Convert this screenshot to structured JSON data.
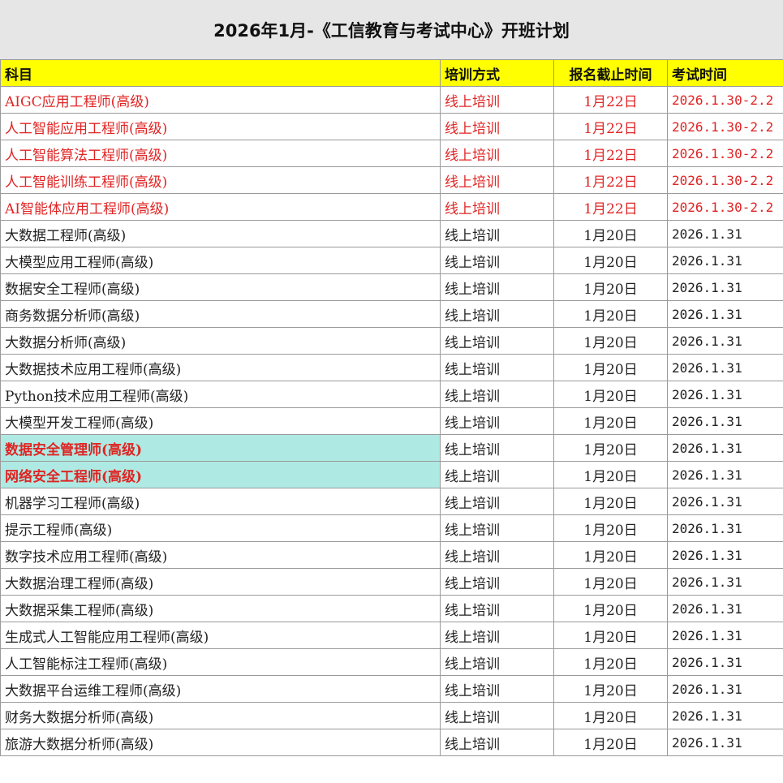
{
  "title": "2026年1月-《工信教育与考试中心》开班计划",
  "headers": {
    "subject": "科目",
    "mode": "培训方式",
    "deadline": "报名截止时间",
    "exam": "考试时间"
  },
  "colors": {
    "header_bg": "#ffff00",
    "highlight_bg": "#aeeae3",
    "red_text": "#e02424"
  },
  "rows": [
    {
      "subject": "AIGC应用工程师(高级)",
      "mode": "线上培训",
      "deadline": "1月22日",
      "exam": "2026.1.30-2.2",
      "style": "red"
    },
    {
      "subject": "人工智能应用工程师(高级)",
      "mode": "线上培训",
      "deadline": "1月22日",
      "exam": "2026.1.30-2.2",
      "style": "red"
    },
    {
      "subject": "人工智能算法工程师(高级)",
      "mode": "线上培训",
      "deadline": "1月22日",
      "exam": "2026.1.30-2.2",
      "style": "red"
    },
    {
      "subject": "人工智能训练工程师(高级)",
      "mode": "线上培训",
      "deadline": "1月22日",
      "exam": "2026.1.30-2.2",
      "style": "red"
    },
    {
      "subject": "AI智能体应用工程师(高级)",
      "mode": "线上培训",
      "deadline": "1月22日",
      "exam": "2026.1.30-2.2",
      "style": "red"
    },
    {
      "subject": "大数据工程师(高级)",
      "mode": "线上培训",
      "deadline": "1月20日",
      "exam": "2026.1.31",
      "style": "normal"
    },
    {
      "subject": "大模型应用工程师(高级)",
      "mode": "线上培训",
      "deadline": "1月20日",
      "exam": "2026.1.31",
      "style": "normal"
    },
    {
      "subject": "数据安全工程师(高级)",
      "mode": "线上培训",
      "deadline": "1月20日",
      "exam": "2026.1.31",
      "style": "normal"
    },
    {
      "subject": "商务数据分析师(高级)",
      "mode": "线上培训",
      "deadline": "1月20日",
      "exam": "2026.1.31",
      "style": "normal"
    },
    {
      "subject": "大数据分析师(高级)",
      "mode": "线上培训",
      "deadline": "1月20日",
      "exam": "2026.1.31",
      "style": "normal"
    },
    {
      "subject": "大数据技术应用工程师(高级)",
      "mode": "线上培训",
      "deadline": "1月20日",
      "exam": "2026.1.31",
      "style": "normal"
    },
    {
      "subject": "Python技术应用工程师(高级)",
      "mode": "线上培训",
      "deadline": "1月20日",
      "exam": "2026.1.31",
      "style": "normal"
    },
    {
      "subject": "大模型开发工程师(高级)",
      "mode": "线上培训",
      "deadline": "1月20日",
      "exam": "2026.1.31",
      "style": "normal"
    },
    {
      "subject": "数据安全管理师(高级)",
      "mode": "线上培训",
      "deadline": "1月20日",
      "exam": "2026.1.31",
      "style": "highlight"
    },
    {
      "subject": "网络安全工程师(高级)",
      "mode": "线上培训",
      "deadline": "1月20日",
      "exam": "2026.1.31",
      "style": "highlight"
    },
    {
      "subject": "机器学习工程师(高级)",
      "mode": "线上培训",
      "deadline": "1月20日",
      "exam": "2026.1.31",
      "style": "normal"
    },
    {
      "subject": "提示工程师(高级)",
      "mode": "线上培训",
      "deadline": "1月20日",
      "exam": "2026.1.31",
      "style": "normal"
    },
    {
      "subject": "数字技术应用工程师(高级)",
      "mode": "线上培训",
      "deadline": "1月20日",
      "exam": "2026.1.31",
      "style": "normal"
    },
    {
      "subject": "大数据治理工程师(高级)",
      "mode": "线上培训",
      "deadline": "1月20日",
      "exam": "2026.1.31",
      "style": "normal"
    },
    {
      "subject": "大数据采集工程师(高级)",
      "mode": "线上培训",
      "deadline": "1月20日",
      "exam": "2026.1.31",
      "style": "normal"
    },
    {
      "subject": "生成式人工智能应用工程师(高级)",
      "mode": "线上培训",
      "deadline": "1月20日",
      "exam": "2026.1.31",
      "style": "normal"
    },
    {
      "subject": "人工智能标注工程师(高级)",
      "mode": "线上培训",
      "deadline": "1月20日",
      "exam": "2026.1.31",
      "style": "normal"
    },
    {
      "subject": "大数据平台运维工程师(高级)",
      "mode": "线上培训",
      "deadline": "1月20日",
      "exam": "2026.1.31",
      "style": "normal"
    },
    {
      "subject": "财务大数据分析师(高级)",
      "mode": "线上培训",
      "deadline": "1月20日",
      "exam": "2026.1.31",
      "style": "normal"
    },
    {
      "subject": "旅游大数据分析师(高级)",
      "mode": "线上培训",
      "deadline": "1月20日",
      "exam": "2026.1.31",
      "style": "normal"
    }
  ]
}
